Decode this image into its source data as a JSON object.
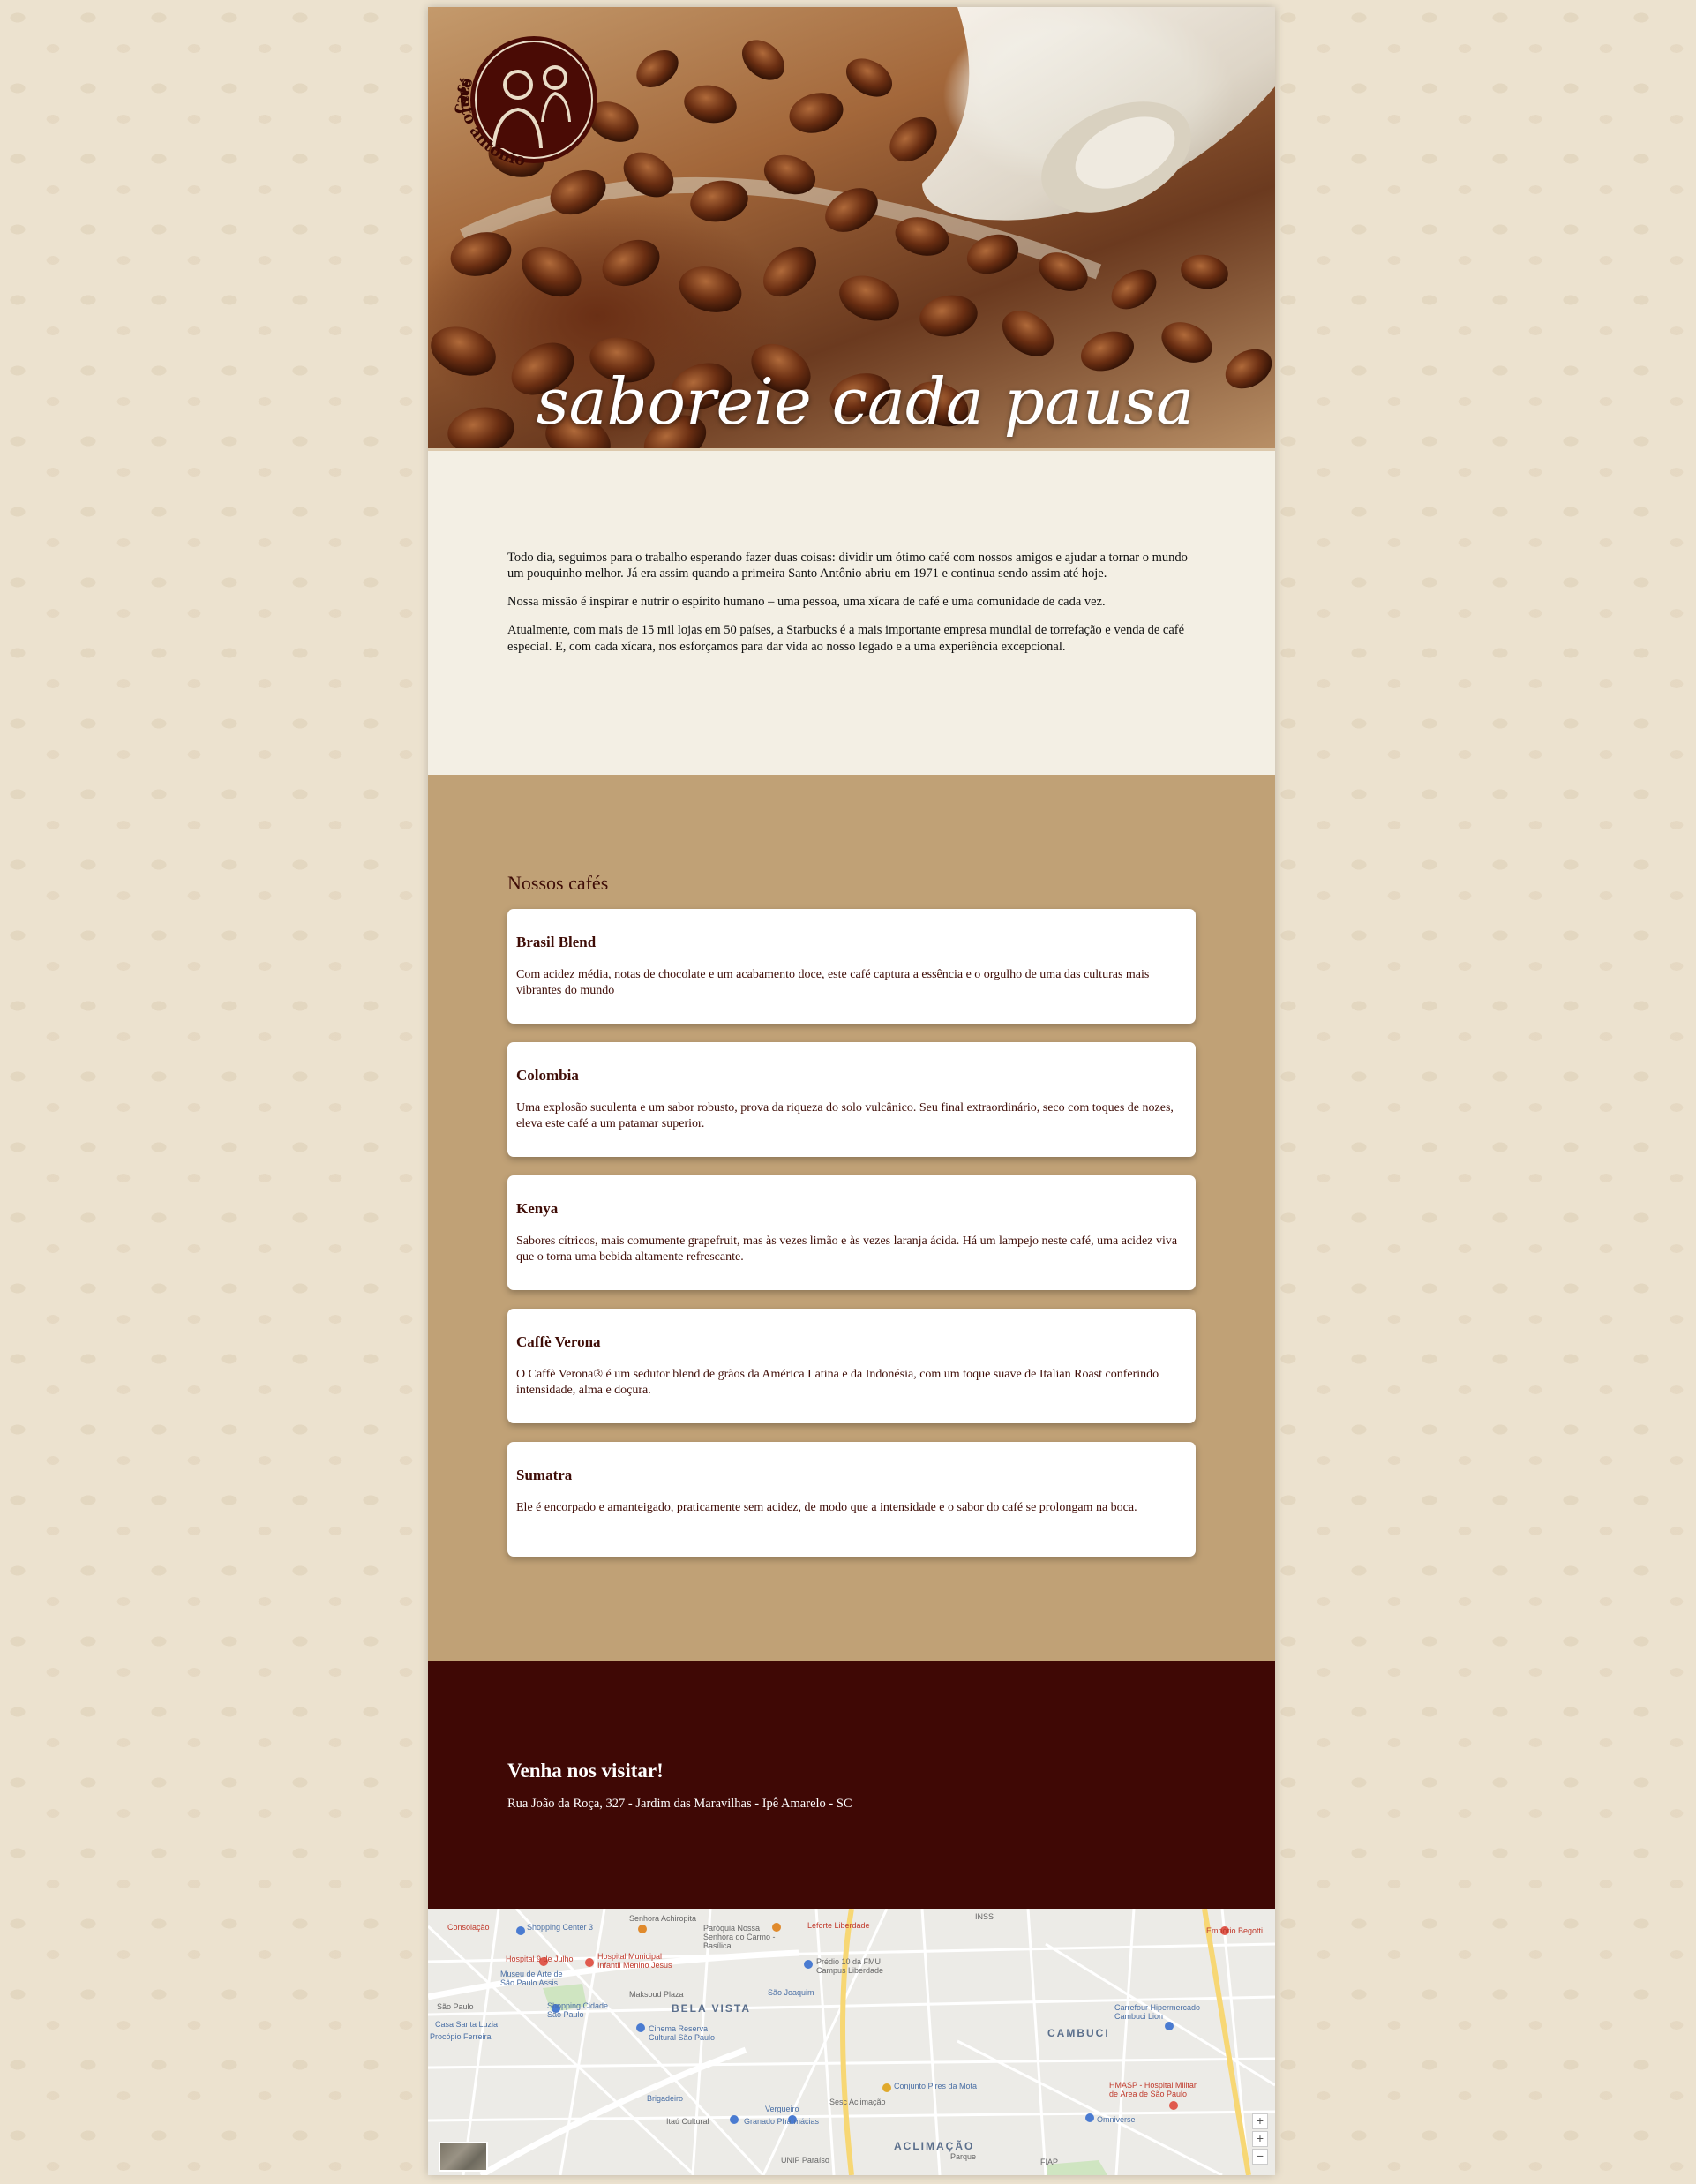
{
  "hero": {
    "logo_word_top": "café",
    "logo_word_bottom": "santo antônio",
    "slogan": "saboreie cada pausa"
  },
  "intro": {
    "paragraphs": [
      "Todo dia, seguimos para o trabalho esperando fazer duas coisas: dividir um ótimo café com nossos amigos e ajudar a tornar o mundo um pouquinho melhor. Já era assim quando a primeira Santo Antônio abriu em 1971 e continua sendo assim até hoje.",
      "Nossa missão é inspirar e nutrir o espírito humano – uma pessoa, uma xícara de café e uma comunidade de cada vez.",
      "Atualmente, com mais de 15 mil lojas em 50 países, a Starbucks é a mais importante empresa mundial de torrefação e venda de café especial. E, com cada xícara, nos esforçamos para dar vida ao nosso legado e a uma experiência excepcional."
    ]
  },
  "coffees": {
    "heading": "Nossos cafés",
    "items": [
      {
        "name": "Brasil Blend",
        "description": "Com acidez média, notas de chocolate e um acabamento doce, este café captura a essência e o orgulho de uma das culturas mais vibrantes do mundo"
      },
      {
        "name": "Colombia",
        "description": "Uma explosão suculenta e um sabor robusto, prova da riqueza do solo vulcânico. Seu final extraordinário, seco com toques de nozes, eleva este café a um patamar superior."
      },
      {
        "name": "Kenya",
        "description": "Sabores cítricos, mais comumente grapefruit, mas às vezes limão e às vezes laranja ácida. Há um lampejo neste café, uma acidez viva que o torna uma bebida altamente refrescante."
      },
      {
        "name": "Caffè Verona",
        "description": "O Caffè Verona® é um sedutor blend de grãos da América Latina e da Indonésia, com um toque suave de Italian Roast conferindo intensidade, alma e doçura."
      },
      {
        "name": "Sumatra",
        "description": "Ele é encorpado e amanteigado, praticamente sem acidez, de modo que a intensidade e o sabor do café se prolongam na boca."
      }
    ]
  },
  "visit": {
    "heading": "Venha nos visitar!",
    "address": "Rua João da Roça, 327 - Jardim das Maravilhas - Ipê Amarelo - SC"
  },
  "map": {
    "labels": {
      "consolacao": "Consolação",
      "shopping_center3": "Shopping Center 3",
      "senhora_achiropita": "Senhora Achiropita",
      "paroquia": "Paróquia Nossa Senhora do Carmo - Basílica",
      "leforte": "Leforte Liberdade",
      "hospital9": "Hospital 9 de Julho",
      "hospital_menino": "Hospital Municipal Infantil Menino Jesus",
      "predio_fmu": "Prédio 10 da FMU Campus Liberdade",
      "masp": "Museu de Arte de São Paulo Assis...",
      "maksoud": "Maksoud Plaza",
      "sao_joaquim": "São Joaquim",
      "bela_vista": "BELA VISTA",
      "shopping_cidade": "Shopping Cidade São Paulo",
      "cinema": "Cinema Reserva Cultural São Paulo",
      "casa_santa_luzia": "Casa Santa Luzia",
      "procopio": "Procópio Ferreira",
      "brigadeiro": "Brigadeiro",
      "conjunto": "Conjunto Pires da Mota",
      "sesc": "Sesc Aclimação",
      "vergueiro": "Vergueiro",
      "itau": "Itaú Cultural",
      "granado": "Granado Pharmácias",
      "aclimacao": "ACLIMAÇÃO",
      "parque": "Parque",
      "unip": "UNIP Paraíso",
      "fiap": "FIAP",
      "cambuci": "CAMBUCI",
      "carrefour": "Carrefour Hipermercado Cambuci Lion",
      "himasp": "HMASP - Hospital Militar de Área de São Paulo",
      "omniverse": "Omniverse",
      "emporio": "Empório Begotti",
      "inss": "INSS",
      "sao_paulo": "São Paulo"
    },
    "zoom_in": "+",
    "zoom_plus2": "+",
    "zoom_out": "−"
  }
}
